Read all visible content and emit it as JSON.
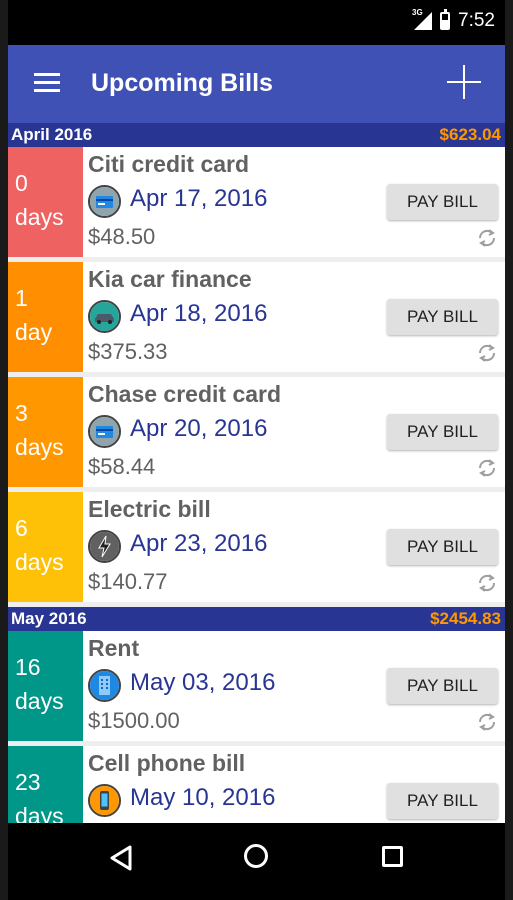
{
  "status_bar": {
    "network": "3G",
    "time": "7:52"
  },
  "app_bar": {
    "title": "Upcoming Bills"
  },
  "groups": [
    {
      "month": "April 2016",
      "total": "$623.04",
      "bills": [
        {
          "days_num": "0",
          "days_unit": "days",
          "color": "#ef6262",
          "name": "Citi credit card",
          "icon": "credit-card-icon",
          "date": "Apr 17, 2016",
          "amount": "$48.50",
          "pay_label": "PAY BILL"
        },
        {
          "days_num": "1",
          "days_unit": "day",
          "color": "#ff8f00",
          "name": "Kia car finance",
          "icon": "car-icon",
          "date": "Apr 18, 2016",
          "amount": "$375.33",
          "pay_label": "PAY BILL"
        },
        {
          "days_num": "3",
          "days_unit": "days",
          "color": "#ff9800",
          "name": "Chase credit card",
          "icon": "credit-card-icon",
          "date": "Apr 20, 2016",
          "amount": "$58.44",
          "pay_label": "PAY BILL"
        },
        {
          "days_num": "6",
          "days_unit": "days",
          "color": "#ffc107",
          "name": "Electric bill",
          "icon": "lightning-icon",
          "date": "Apr 23, 2016",
          "amount": "$140.77",
          "pay_label": "PAY BILL"
        }
      ]
    },
    {
      "month": "May 2016",
      "total": "$2454.83",
      "bills": [
        {
          "days_num": "16",
          "days_unit": "days",
          "color": "#009688",
          "name": "Rent",
          "icon": "building-icon",
          "date": "May 03, 2016",
          "amount": "$1500.00",
          "pay_label": "PAY BILL"
        },
        {
          "days_num": "23",
          "days_unit": "days",
          "color": "#009688",
          "name": "Cell phone bill",
          "icon": "phone-icon",
          "date": "May 10, 2016",
          "amount": "",
          "pay_label": "PAY BILL"
        }
      ]
    }
  ],
  "colors": {
    "app_bar": "#3f51b5",
    "month_header": "#283593",
    "month_total": "#ff9800",
    "date_text": "#283593"
  }
}
